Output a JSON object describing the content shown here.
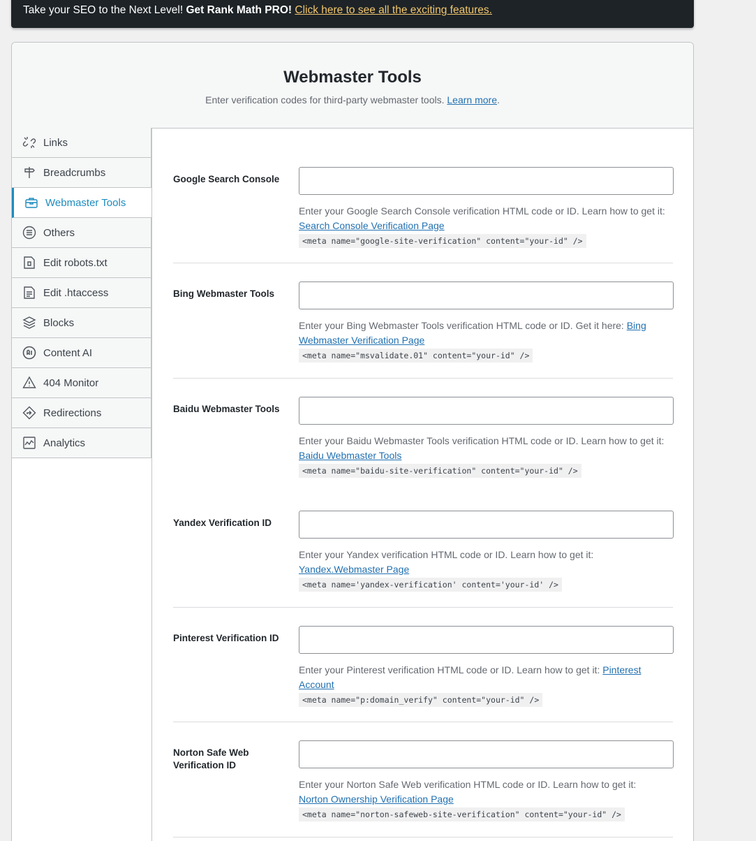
{
  "promo": {
    "lead": "Take your SEO to the Next Level! ",
    "bold": "Get Rank Math PRO!",
    "link": "Click here to see all the exciting features."
  },
  "header": {
    "title": "Webmaster Tools",
    "subtitle": "Enter verification codes for third-party webmaster tools. ",
    "learn_more": "Learn more",
    "period": "."
  },
  "nav": [
    {
      "label": "Links",
      "icon": "links-icon"
    },
    {
      "label": "Breadcrumbs",
      "icon": "signpost-icon"
    },
    {
      "label": "Webmaster Tools",
      "icon": "toolbox-icon",
      "active": true
    },
    {
      "label": "Others",
      "icon": "list-circle-icon"
    },
    {
      "label": "Edit robots.txt",
      "icon": "robot-file-icon"
    },
    {
      "label": "Edit .htaccess",
      "icon": "document-icon"
    },
    {
      "label": "Blocks",
      "icon": "blocks-icon"
    },
    {
      "label": "Content AI",
      "icon": "content-ai-icon"
    },
    {
      "label": "404 Monitor",
      "icon": "warning-icon"
    },
    {
      "label": "Redirections",
      "icon": "redirect-icon"
    },
    {
      "label": "Analytics",
      "icon": "analytics-icon"
    }
  ],
  "fields": [
    {
      "label": "Google Search Console",
      "value": "",
      "desc": "Enter your Google Search Console verification HTML code or ID. Learn how to get it: ",
      "link": "Search Console Verification Page",
      "code": "<meta name=\"google-site-verification\" content=\"your-id\" />"
    },
    {
      "label": "Bing Webmaster Tools",
      "value": "",
      "desc": "Enter your Bing Webmaster Tools verification HTML code or ID. Get it here: ",
      "link": "Bing Webmaster Verification Page",
      "code": "<meta name=\"msvalidate.01\" content=\"your-id\" />"
    },
    {
      "label": "Baidu Webmaster Tools",
      "value": "",
      "desc": "Enter your Baidu Webmaster Tools verification HTML code or ID. Learn how to get it: ",
      "link": "Baidu Webmaster Tools",
      "code": "<meta name=\"baidu-site-verification\" content=\"your-id\" />"
    },
    {
      "label": "Yandex Verification ID",
      "value": "",
      "desc": "Enter your Yandex verification HTML code or ID. Learn how to get it: ",
      "link": "Yandex.Webmaster Page",
      "code": "<meta name='yandex-verification' content='your-id' />"
    },
    {
      "label": "Pinterest Verification ID",
      "value": "",
      "desc": "Enter your Pinterest verification HTML code or ID. Learn how to get it: ",
      "link": "Pinterest Account",
      "code": "<meta name=\"p:domain_verify\" content=\"your-id\" />"
    },
    {
      "label": "Norton Safe Web Verification ID",
      "value": "",
      "desc": "Enter your Norton Safe Web verification HTML code or ID. Learn how to get it: ",
      "link": "Norton Ownership Verification Page",
      "code": "<meta name=\"norton-safeweb-site-verification\" content=\"your-id\" />"
    }
  ],
  "colors": {
    "accent": "#1e8cbe",
    "link": "#2271b1",
    "promo_bg": "#1d2327",
    "promo_link": "#f2c66d"
  }
}
